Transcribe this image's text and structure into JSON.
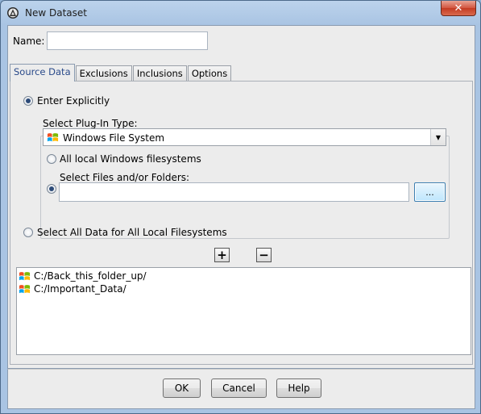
{
  "window": {
    "title": "New Dataset",
    "close_glyph": "✕",
    "app_icon": "dataset-app-icon"
  },
  "name_field": {
    "label": "Name:",
    "value": ""
  },
  "tabs": [
    {
      "label": "Source Data",
      "active": true
    },
    {
      "label": "Exclusions",
      "active": false
    },
    {
      "label": "Inclusions",
      "active": false
    },
    {
      "label": "Options",
      "active": false
    }
  ],
  "source": {
    "enter_explicitly_label": "Enter Explicitly",
    "plugin_type_label": "Select Plug-In Type:",
    "plugin_type_value": "Windows File System",
    "all_local_label": "All local Windows filesystems",
    "select_files_label": "Select Files and/or Folders:",
    "select_files_value": "",
    "browse_label": "...",
    "select_all_label": "Select All Data for All Local Filesystems",
    "add_glyph": "+",
    "remove_glyph": "−"
  },
  "selected_paths": [
    "C:/Back_this_folder_up/",
    "C:/Important_Data/"
  ],
  "buttons": {
    "ok": "OK",
    "cancel": "Cancel",
    "help": "Help"
  },
  "colors": {
    "title_bar": "#bcd3ec",
    "close_button": "#c43b22",
    "dialog_bg": "#ececec",
    "accent_tab_text": "#2a4a8a"
  }
}
